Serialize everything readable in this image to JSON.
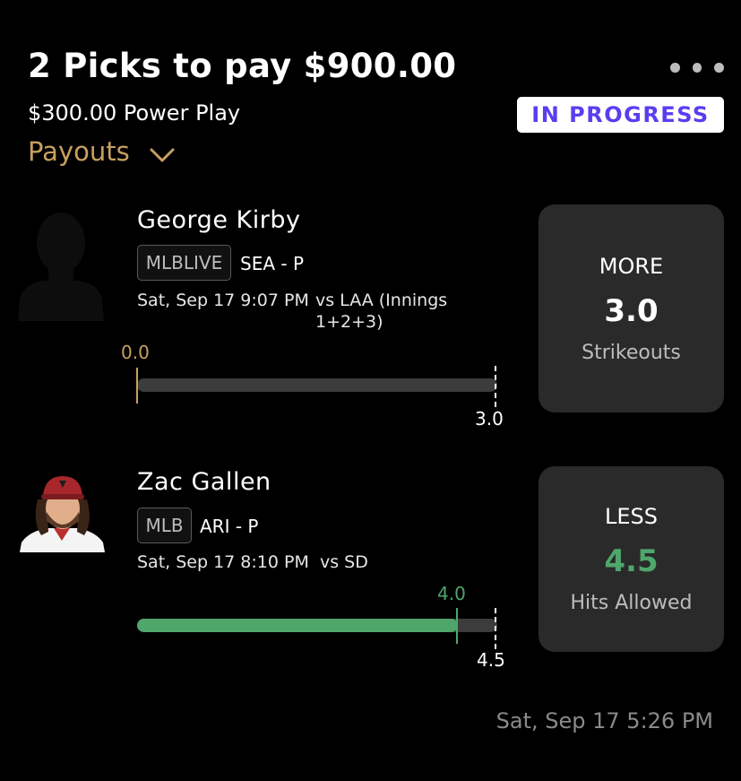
{
  "header": {
    "title": "2 Picks to pay $900.00",
    "subtitle": "$300.00 Power Play",
    "status": "IN PROGRESS",
    "payouts_label": "Payouts"
  },
  "picks": [
    {
      "player": "George Kirby",
      "league": "MLBLIVE",
      "team_pos": "SEA - P",
      "game_time": "Sat, Sep 17 9:07 PM",
      "game_detail_1": "vs LAA (Innings",
      "game_detail_2": "1+2+3)",
      "current": "0.0",
      "current_value": 0.0,
      "target": "3.0",
      "target_value": 3.0,
      "direction": "MORE",
      "line": "3.0",
      "stat": "Strikeouts",
      "avatar_icon": "player-silhouette-icon"
    },
    {
      "player": "Zac Gallen",
      "league": "MLB",
      "team_pos": "ARI - P",
      "game_time": "Sat, Sep 17 8:10 PM",
      "game_detail_1": "vs SD",
      "current": "4.0",
      "current_value": 4.0,
      "target": "4.5",
      "target_value": 4.5,
      "direction": "LESS",
      "line": "4.5",
      "stat": "Hits Allowed",
      "avatar_icon": "player-photo"
    }
  ],
  "footer": {
    "timestamp": "Sat, Sep 17 5:26 PM"
  },
  "colors": {
    "background": "#000000",
    "status_text": "#5b3df0",
    "payouts": "#c8a060",
    "progress_green": "#4ea66b",
    "card": "#2a2a2a"
  }
}
